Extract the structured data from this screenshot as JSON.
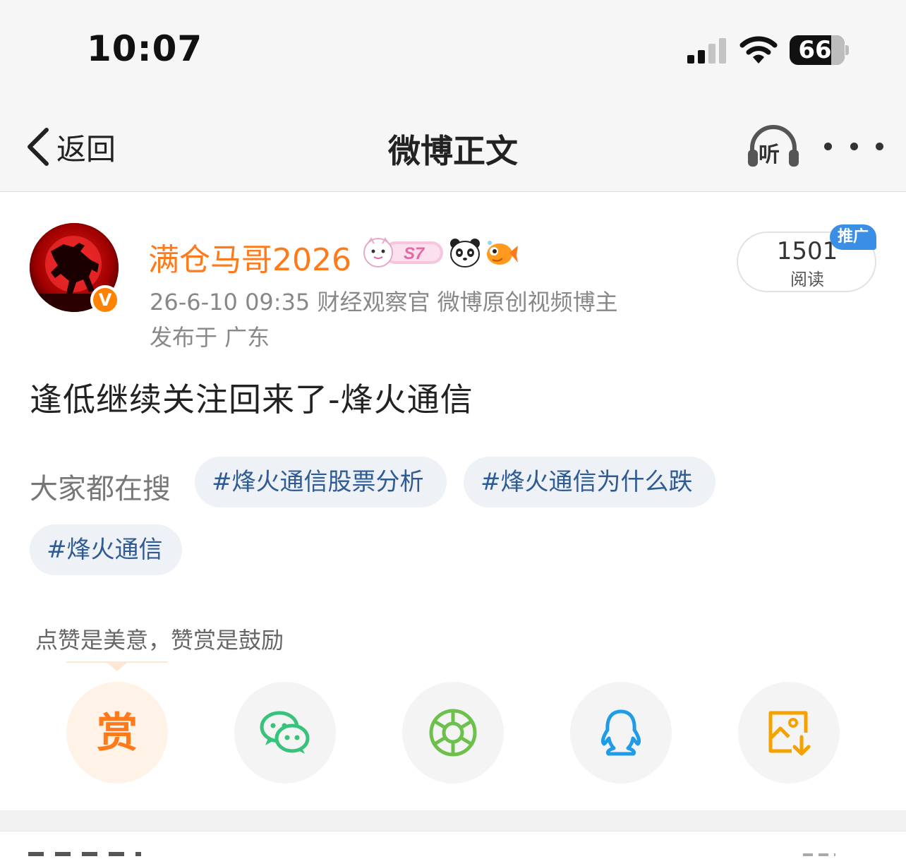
{
  "status_bar": {
    "time": "10:07",
    "battery_level": "66",
    "icons": [
      "signal-icon",
      "wifi-icon",
      "battery-icon"
    ]
  },
  "nav": {
    "back_label": "返回",
    "title": "微博正文",
    "listen_label": "听",
    "more_icon": "more-dots-icon"
  },
  "post": {
    "author": {
      "name": "满仓马哥2026",
      "verified_icon": "verified-v-icon",
      "badges": [
        "s7-member-badge",
        "panda-badge",
        "goldfish-badge"
      ],
      "s7_label": "S7"
    },
    "meta": {
      "line1": "26-6-10 09:35  财经观察官 微博原创视频博主",
      "line2": "发布于 广东"
    },
    "reads": {
      "count": "1501",
      "label": "阅读",
      "promo": "推广"
    },
    "text": "逢低继续关注回来了-烽火通信",
    "search_label": "大家都在搜",
    "tags": [
      "#烽火通信股票分析",
      "#烽火通信为什么跌",
      "#烽火通信"
    ]
  },
  "reward": {
    "tip": "点赞是美意，赞赏是鼓励",
    "button_label": "赏"
  },
  "share": {
    "buttons": [
      "reward-icon",
      "wechat-icon",
      "moments-icon",
      "qq-icon",
      "save-image-icon"
    ]
  },
  "colors": {
    "accent_orange": "#ff7a1a",
    "tag_blue": "#2f5b95",
    "wechat_green": "#37c37a",
    "moments_green": "#6dc04b",
    "qq_blue": "#1e9ce8",
    "save_orange": "#f5a100",
    "promo_blue": "#3a8ee6"
  }
}
